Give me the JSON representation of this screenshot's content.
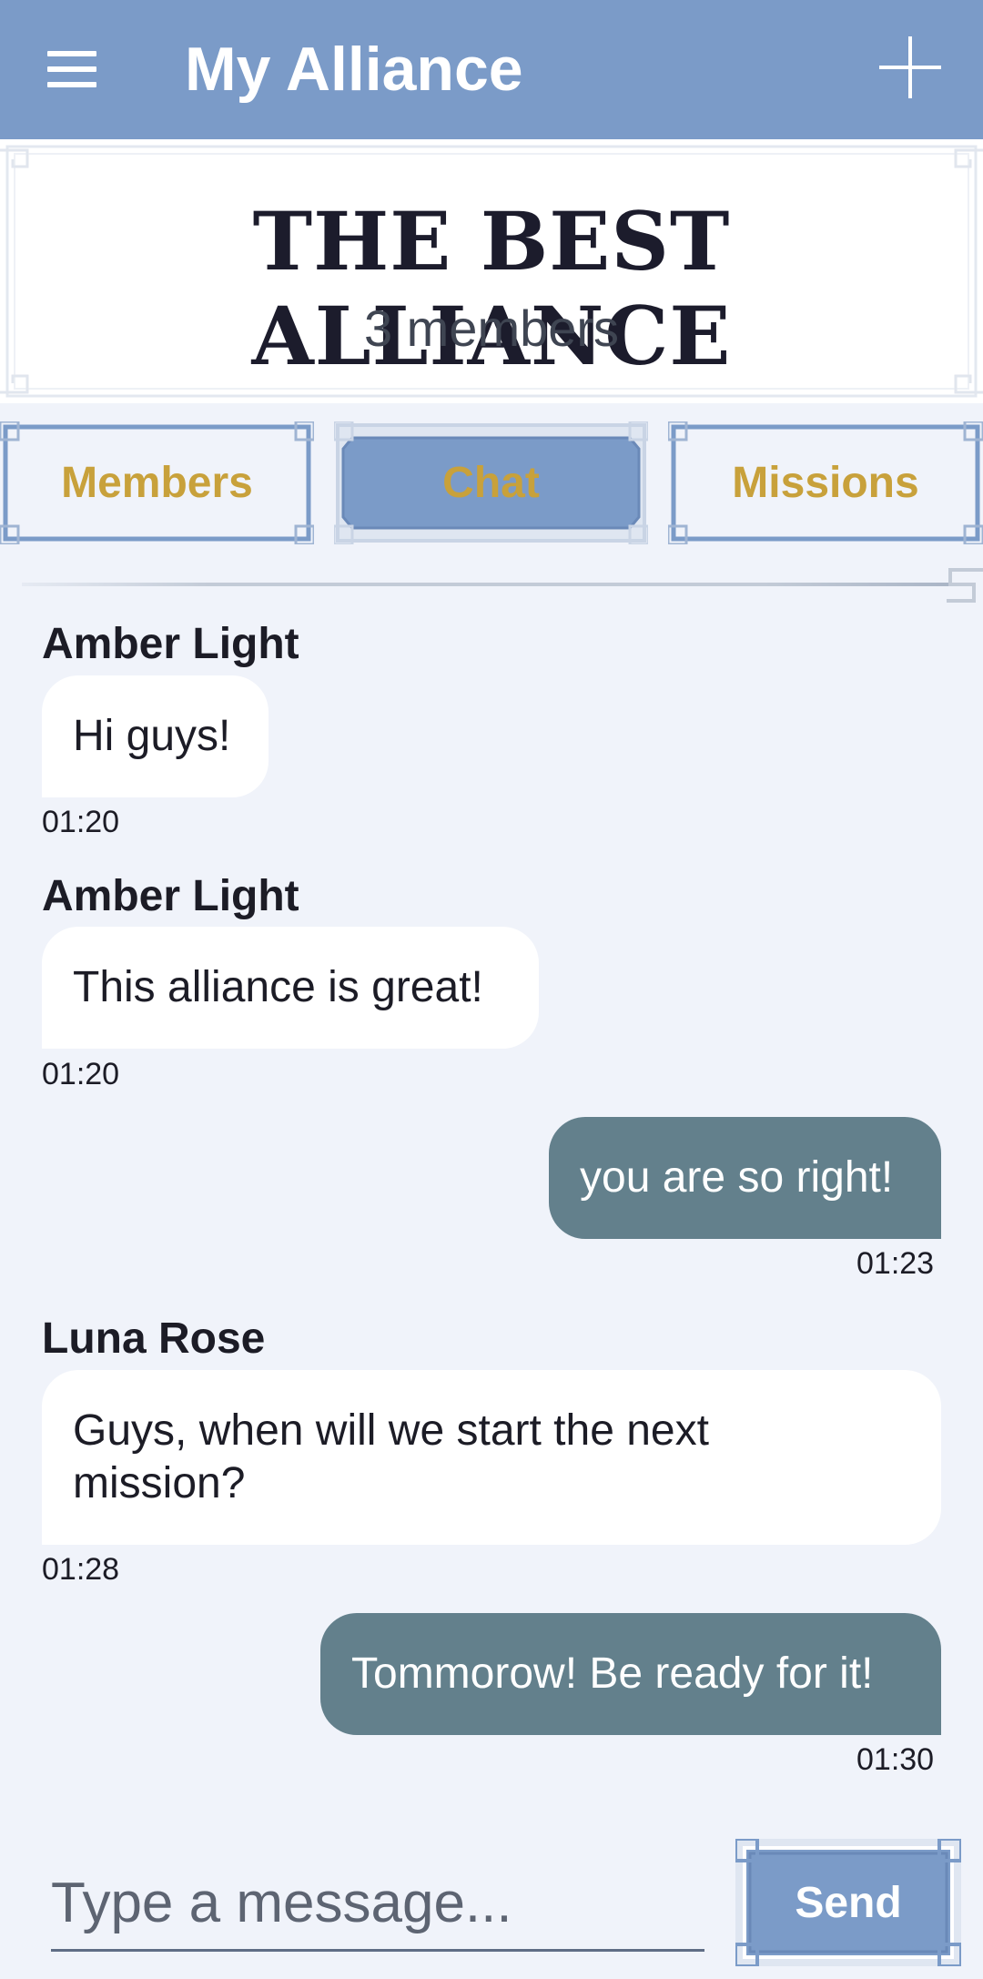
{
  "app_bar": {
    "title": "My Alliance",
    "menu_icon": "hamburger-menu-icon",
    "add_icon": "plus-icon"
  },
  "alliance": {
    "name": "THE BEST ALLIANCE",
    "members_text": "3 members"
  },
  "tabs": [
    {
      "label": "Members",
      "active": false
    },
    {
      "label": "Chat",
      "active": true
    },
    {
      "label": "Missions",
      "active": false
    }
  ],
  "messages": [
    {
      "sender": "Amber Light",
      "text": "Hi guys!",
      "time": "01:20",
      "outgoing": false
    },
    {
      "sender": "Amber Light",
      "text": "This alliance is great!",
      "time": "01:20",
      "outgoing": false
    },
    {
      "sender": "",
      "text": "you are so right!",
      "time": "01:23",
      "outgoing": true
    },
    {
      "sender": "Luna Rose",
      "text": "Guys, when will we start the next mission?",
      "time": "01:28",
      "outgoing": false
    },
    {
      "sender": "",
      "text": "Tommorow! Be ready for it!",
      "time": "01:30",
      "outgoing": true
    }
  ],
  "composer": {
    "placeholder": "Type a message...",
    "value": "",
    "send_label": "Send"
  },
  "colors": {
    "app_bar": "#7b9bc8",
    "tab_label": "#c8a13b",
    "outgoing_bubble": "#63808c",
    "incoming_bubble": "#ffffff",
    "background": "#f0f3fa"
  }
}
